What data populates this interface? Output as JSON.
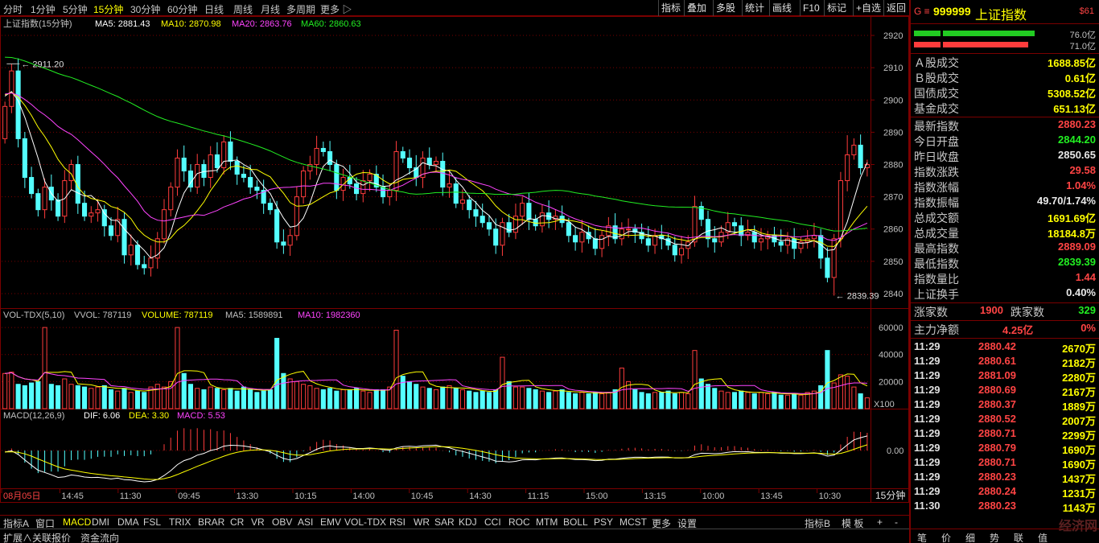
{
  "toolbar": {
    "periods": [
      "分时",
      "1分钟",
      "5分钟",
      "15分钟",
      "30分钟",
      "60分钟",
      "日线",
      "周线",
      "月线",
      "多周期",
      "更多 ▷"
    ],
    "active_period": "15分钟",
    "right_buttons": [
      "指标",
      "叠加",
      "多股",
      "统计",
      "画线",
      "F10",
      "标记",
      "+自选",
      "返回"
    ]
  },
  "main_legend": {
    "name": "上证指数(15分钟)",
    "ma5": "MA5: 2881.43",
    "ma10": "MA10: 2870.98",
    "ma20": "MA20: 2863.76",
    "ma60": "MA60: 2860.63"
  },
  "volume_legend": {
    "name": "VOL-TDX(5,10)",
    "vvol": "VVOL: 787119",
    "volume": "VOLUME: 787119",
    "ma5": "MA5: 1589891",
    "ma10": "MA10: 1982360"
  },
  "macd_legend": {
    "name": "MACD(12,26,9)",
    "dif": "DIF: 6.06",
    "dea": "DEA: 3.30",
    "macd": "MACD: 5.53"
  },
  "annotations": {
    "high": "2911.20",
    "low": "2839.39"
  },
  "colors": {
    "up": "#ff3c3c",
    "down": "#54ffff",
    "ma5": "#ffffff",
    "ma10": "#ffff00",
    "ma20": "#ff44ff",
    "ma60": "#22ee22",
    "grid": "#7a0000"
  },
  "chart_data": [
    {
      "type": "candlestick",
      "title": "上证指数(15分钟)",
      "y_ticks": [
        2840,
        2850,
        2860,
        2870,
        2880,
        2890,
        2900,
        2910,
        2920
      ],
      "ylim": [
        2838,
        2923
      ],
      "x_ticks": [
        "08月05日",
        "14:45",
        "11:30",
        "09:45",
        "13:30",
        "10:15",
        "14:00",
        "10:45",
        "14:30",
        "11:15",
        "15:00",
        "13:15",
        "10:00",
        "13:45",
        "10:30"
      ],
      "close": [
        2898,
        2909,
        2888,
        2876,
        2871,
        2866,
        2873,
        2869,
        2864,
        2875,
        2880,
        2868,
        2864,
        2865,
        2866,
        2861,
        2858,
        2863,
        2852,
        2855,
        2849,
        2848,
        2851,
        2857,
        2866,
        2873,
        2882,
        2878,
        2873,
        2880,
        2876,
        2883,
        2879,
        2887,
        2881,
        2877,
        2876,
        2873,
        2872,
        2868,
        2866,
        2856,
        2855,
        2858,
        2870,
        2878,
        2880,
        2885,
        2884,
        2880,
        2872,
        2876,
        2874,
        2871,
        2875,
        2877,
        2873,
        2870,
        2872,
        2884,
        2882,
        2879,
        2876,
        2882,
        2880,
        2881,
        2873,
        2874,
        2868,
        2869,
        2866,
        2864,
        2862,
        2860,
        2855,
        2862,
        2859,
        2864,
        2868,
        2863,
        2861,
        2865,
        2863,
        2864,
        2862,
        2858,
        2856,
        2859,
        2857,
        2854,
        2858,
        2861,
        2857,
        2860,
        2860,
        2859,
        2857,
        2855,
        2858,
        2857,
        2855,
        2852,
        2854,
        2856,
        2867,
        2863,
        2857,
        2856,
        2859,
        2862,
        2861,
        2858,
        2859,
        2856,
        2857,
        2858,
        2856,
        2855,
        2857,
        2854,
        2856,
        2857,
        2858,
        2851,
        2845,
        2857,
        2875,
        2883,
        2886,
        2879,
        2880
      ],
      "volume": [
        26000,
        27000,
        18000,
        17000,
        19000,
        20000,
        60000,
        18000,
        17000,
        22000,
        18000,
        17000,
        16000,
        15000,
        16000,
        17000,
        14000,
        13000,
        15000,
        12000,
        13000,
        12000,
        16000,
        18000,
        16000,
        20000,
        60000,
        26000,
        18000,
        15000,
        14000,
        16000,
        15000,
        14000,
        15000,
        13000,
        16000,
        14000,
        12000,
        13000,
        14000,
        52000,
        26000,
        22000,
        20000,
        18000,
        17000,
        15000,
        14000,
        15000,
        13000,
        14000,
        14000,
        15000,
        13000,
        12000,
        14000,
        14000,
        16000,
        58000,
        24000,
        20000,
        18000,
        16000,
        15000,
        14000,
        16000,
        17000,
        15000,
        14000,
        13000,
        12000,
        13000,
        12000,
        14000,
        38000,
        20000,
        16000,
        16000,
        15000,
        14000,
        13000,
        12000,
        13000,
        14000,
        12000,
        11000,
        12000,
        11000,
        12000,
        11000,
        12000,
        14000,
        30000,
        20000,
        14000,
        12000,
        11000,
        12000,
        12000,
        13000,
        11000,
        12000,
        11000,
        43000,
        22000,
        18000,
        15000,
        13000,
        12000,
        12000,
        13000,
        12000,
        11000,
        12000,
        11000,
        12000,
        10000,
        10000,
        11000,
        10000,
        12000,
        13000,
        17000,
        43000,
        19000,
        25000,
        24000,
        16000,
        11000,
        8000
      ],
      "vol_ticks": [
        20000,
        40000,
        60000
      ],
      "macd_zero_label": "0.00"
    }
  ],
  "right_panel": {
    "prefix": "G ≡",
    "code": "999999",
    "name": "上证指数",
    "badge": "$61",
    "bar1_value": "76.0亿",
    "bar2_value": "71.0亿",
    "stats1": [
      {
        "label": "Ａ股成交",
        "value": "1688.85亿",
        "color": "yellow"
      },
      {
        "label": "Ｂ股成交",
        "value": "0.61亿",
        "color": "yellow"
      },
      {
        "label": "国债成交",
        "value": "5308.52亿",
        "color": "yellow"
      },
      {
        "label": "基金成交",
        "value": "651.13亿",
        "color": "yellow"
      }
    ],
    "stats2": [
      {
        "label": "最新指数",
        "value": "2880.23",
        "color": "red"
      },
      {
        "label": "今日开盘",
        "value": "2844.20",
        "color": "green"
      },
      {
        "label": "昨日收盘",
        "value": "2850.65",
        "color": "white"
      },
      {
        "label": "指数涨跌",
        "value": "29.58",
        "color": "red"
      },
      {
        "label": "指数涨幅",
        "value": "1.04%",
        "color": "red"
      },
      {
        "label": "指数振幅",
        "value": "49.70/1.74%",
        "color": "white"
      },
      {
        "label": "总成交额",
        "value": "1691.69亿",
        "color": "yellow"
      },
      {
        "label": "总成交量",
        "value": "18184.8万",
        "color": "yellow"
      },
      {
        "label": "最高指数",
        "value": "2889.09",
        "color": "red"
      },
      {
        "label": "最低指数",
        "value": "2839.39",
        "color": "green"
      },
      {
        "label": "指数量比",
        "value": "1.44",
        "color": "red"
      },
      {
        "label": "上证换手",
        "value": "0.40%",
        "color": "white"
      }
    ],
    "rise_label": "涨家数",
    "rise_value": "1900",
    "fall_label": "跌家数",
    "fall_value": "329",
    "net_label": "主力净额",
    "net_value": "4.25亿",
    "net_pct": "0%",
    "ticks": [
      {
        "time": "11:29",
        "price": "2880.42",
        "vol": "2670万"
      },
      {
        "time": "11:29",
        "price": "2880.61",
        "vol": "2182万"
      },
      {
        "time": "11:29",
        "price": "2881.09",
        "vol": "2280万"
      },
      {
        "time": "11:29",
        "price": "2880.69",
        "vol": "2167万"
      },
      {
        "time": "11:29",
        "price": "2880.37",
        "vol": "1889万"
      },
      {
        "time": "11:29",
        "price": "2880.52",
        "vol": "2007万"
      },
      {
        "time": "11:29",
        "price": "2880.71",
        "vol": "2299万"
      },
      {
        "time": "11:29",
        "price": "2880.79",
        "vol": "1690万"
      },
      {
        "time": "11:29",
        "price": "2880.71",
        "vol": "1690万"
      },
      {
        "time": "11:29",
        "price": "2880.23",
        "vol": "1437万"
      },
      {
        "time": "11:29",
        "price": "2880.24",
        "vol": "1231万"
      },
      {
        "time": "11:30",
        "price": "2880.23",
        "vol": "1143万"
      }
    ],
    "tabs": [
      "笔",
      "价",
      "细",
      "势",
      "联",
      "值"
    ]
  },
  "tabs1": [
    "指标A",
    "窗口",
    "MACD",
    "DMI",
    "DMA",
    "FSL",
    "TRIX",
    "BRAR",
    "CR",
    "VR",
    "OBV",
    "ASI",
    "EMV",
    "VOL-TDX",
    "RSI",
    "WR",
    "SAR",
    "KDJ",
    "CCI",
    "ROC",
    "MTM",
    "BOLL",
    "PSY",
    "MCST",
    "更多",
    "设置"
  ],
  "tabs1_right": [
    "指标B",
    "模 板",
    "+",
    "-"
  ],
  "tabs2": [
    "扩展∧",
    "关联报价",
    "资金流向"
  ],
  "period_label": "15分钟",
  "x100": "X100",
  "watermark": "经济网"
}
